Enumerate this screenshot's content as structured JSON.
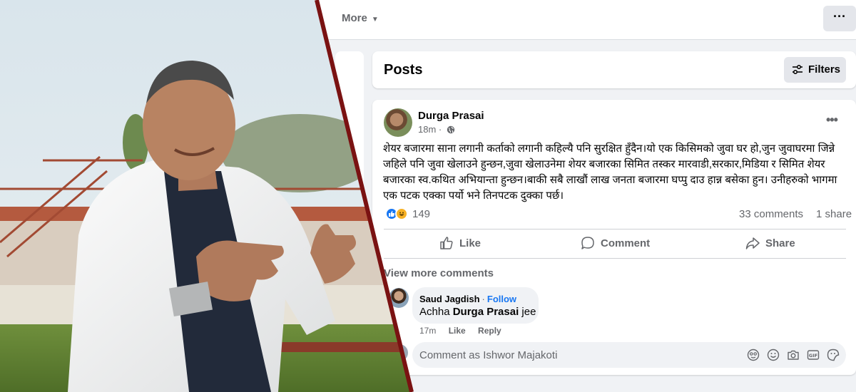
{
  "nav": {
    "more_label": "More",
    "more_caret": "▼",
    "overflow_label": "···"
  },
  "posts_header": {
    "title": "Posts",
    "filters_label": "Filters"
  },
  "post": {
    "author": "Durga Prasai",
    "time": "18m",
    "text": "शेयर बजारमा साना लगानी कर्ताको लगानी कहिल्यै पनि सुरक्षित हुँदैन।यो एक किसिमको जुवा घर हो,जुन जुवाघरमा जिन्ने जहिले पनि जुवा खेलाउने हुन्छन,जुवा खेलाउनेमा शेयर बजारका सिमित तस्कर मारवाडी,सरकार,मिडिया र सिमित शेयर बजारका स्व.कथित अभियान्ता हुन्छन।बाकी सबै लाखौं लाख जनता बजारमा घप्पु दाउ हान्न बसेका हुन। उनीहरुको भागमा एक पटक एक्का पर्यो भने तिनपटक दुक्का पर्छ।",
    "reactions_count": "149",
    "comments_count": "33 comments",
    "shares_count": "1 share",
    "more_label": "•••"
  },
  "actions": {
    "like": "Like",
    "comment": "Comment",
    "share": "Share"
  },
  "comments": {
    "view_more": "View more comments",
    "items": [
      {
        "name": "Saud Jagdish",
        "separator": "·",
        "follow": "Follow",
        "text_prefix": "Achha ",
        "mention": "Durga Prasai",
        "text_suffix": " jee",
        "time": "17m",
        "like": "Like",
        "reply": "Reply"
      }
    ],
    "composer_placeholder": "Comment as Ishwor Majakoti"
  },
  "colors": {
    "accent": "#1877f2",
    "secondary_text": "#65676b",
    "divider": "#7a1212"
  }
}
